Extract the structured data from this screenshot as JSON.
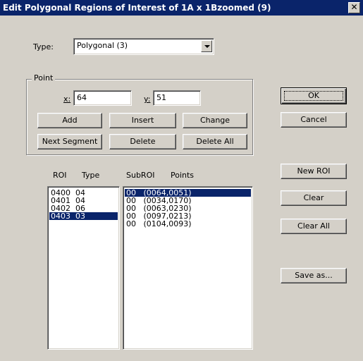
{
  "window": {
    "title": "Edit Polygonal Regions of Interest of 1A x 1Bzoomed (9)",
    "close_glyph": "✕"
  },
  "type_label": "Type:",
  "type_select": {
    "value": "Polygonal (3)"
  },
  "point_group": {
    "title": "Point",
    "x_label": "x:",
    "x_value": "64",
    "y_label": "y:",
    "y_value": "51"
  },
  "buttons": {
    "add": "Add",
    "insert": "Insert",
    "change": "Change",
    "next_segment": "Next Segment",
    "delete": "Delete",
    "delete_all": "Delete All",
    "ok": "OK",
    "cancel": "Cancel",
    "new_roi": "New ROI",
    "clear": "Clear",
    "clear_all": "Clear All",
    "save_as": "Save as..."
  },
  "list_headers": {
    "roi": "ROI",
    "type": "Type",
    "subroi": "SubROI",
    "points": "Points"
  },
  "roi_list": [
    {
      "text": "0400  04",
      "selected": false
    },
    {
      "text": "0401  04",
      "selected": false
    },
    {
      "text": "0402  06",
      "selected": false
    },
    {
      "text": "0403  03",
      "selected": true
    }
  ],
  "points_list": [
    {
      "text": "00   (0064,0051)",
      "selected": true
    },
    {
      "text": "00   (0034,0170)",
      "selected": false
    },
    {
      "text": "00   (0063,0230)",
      "selected": false
    },
    {
      "text": "00   (0097,0213)",
      "selected": false
    },
    {
      "text": "00   (0104,0093)",
      "selected": false
    }
  ]
}
